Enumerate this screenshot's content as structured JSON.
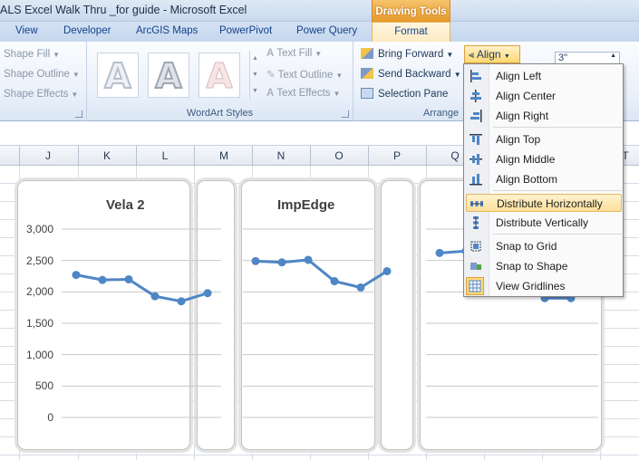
{
  "window": {
    "title": "ALS Excel Walk Thru _for guide  -  Microsoft Excel",
    "context_tab_group": "Drawing Tools"
  },
  "tabs": [
    {
      "label": "View"
    },
    {
      "label": "Developer"
    },
    {
      "label": "ArcGIS Maps"
    },
    {
      "label": "PowerPivot"
    },
    {
      "label": "Power Query"
    },
    {
      "label": "Format"
    }
  ],
  "ribbon": {
    "shape_styles": {
      "shape_fill": "Shape Fill",
      "shape_outline": "Shape Outline",
      "shape_effects": "Shape Effects"
    },
    "wordart": {
      "sample_glyph": "A",
      "text_fill": "Text Fill",
      "text_outline": "Text Outline",
      "text_effects": "Text Effects",
      "label": "WordArt Styles"
    },
    "arrange": {
      "bring_forward": "Bring Forward",
      "send_backward": "Send Backward",
      "selection_pane": "Selection Pane",
      "align": "Align",
      "label": "Arrange"
    },
    "size": {
      "height_value": "3\""
    }
  },
  "columns": [
    "J",
    "K",
    "L",
    "M",
    "N",
    "O",
    "P",
    "Q",
    "T"
  ],
  "align_menu": {
    "items": [
      {
        "label": "Align Left",
        "icon": "align-left-icon"
      },
      {
        "label": "Align Center",
        "icon": "align-center-icon"
      },
      {
        "label": "Align Right",
        "icon": "align-right-icon"
      },
      {
        "label": "Align Top",
        "icon": "align-top-icon"
      },
      {
        "label": "Align Middle",
        "icon": "align-middle-icon"
      },
      {
        "label": "Align Bottom",
        "icon": "align-bottom-icon"
      },
      {
        "label": "Distribute Horizontally",
        "icon": "distribute-horizontally-icon",
        "highlighted": true
      },
      {
        "label": "Distribute Vertically",
        "icon": "distribute-vertically-icon"
      },
      {
        "label": "Snap to Grid",
        "icon": "snap-to-grid-icon"
      },
      {
        "label": "Snap to Shape",
        "icon": "snap-to-shape-icon"
      },
      {
        "label": "View Gridlines",
        "icon": "view-gridlines-icon"
      }
    ]
  },
  "colors": {
    "line": "#4f86c6",
    "highlight": "#ffe19a",
    "context_tab": "#e69a2b"
  },
  "chart_data": [
    {
      "type": "line",
      "title": "Vela 2",
      "ylim": [
        0,
        3000
      ],
      "yticks": [
        "3,000",
        "2,500",
        "2,000",
        "1,500",
        "1,000",
        "500",
        "0"
      ],
      "grid": true,
      "series": [
        {
          "values": [
            2270,
            2190,
            2200,
            1930,
            1850,
            1980
          ]
        }
      ]
    },
    {
      "type": "line",
      "title": "ImpEdge",
      "ylim": [
        0,
        3000
      ],
      "grid": true,
      "series": [
        {
          "values": [
            2490,
            2470,
            2510,
            2170,
            2070,
            2330
          ]
        }
      ]
    },
    {
      "type": "line",
      "title": "",
      "ylim": [
        0,
        3000
      ],
      "grid": true,
      "series": [
        {
          "values": [
            2620,
            2650,
            2600,
            2450,
            1900,
            1900
          ]
        }
      ]
    }
  ]
}
